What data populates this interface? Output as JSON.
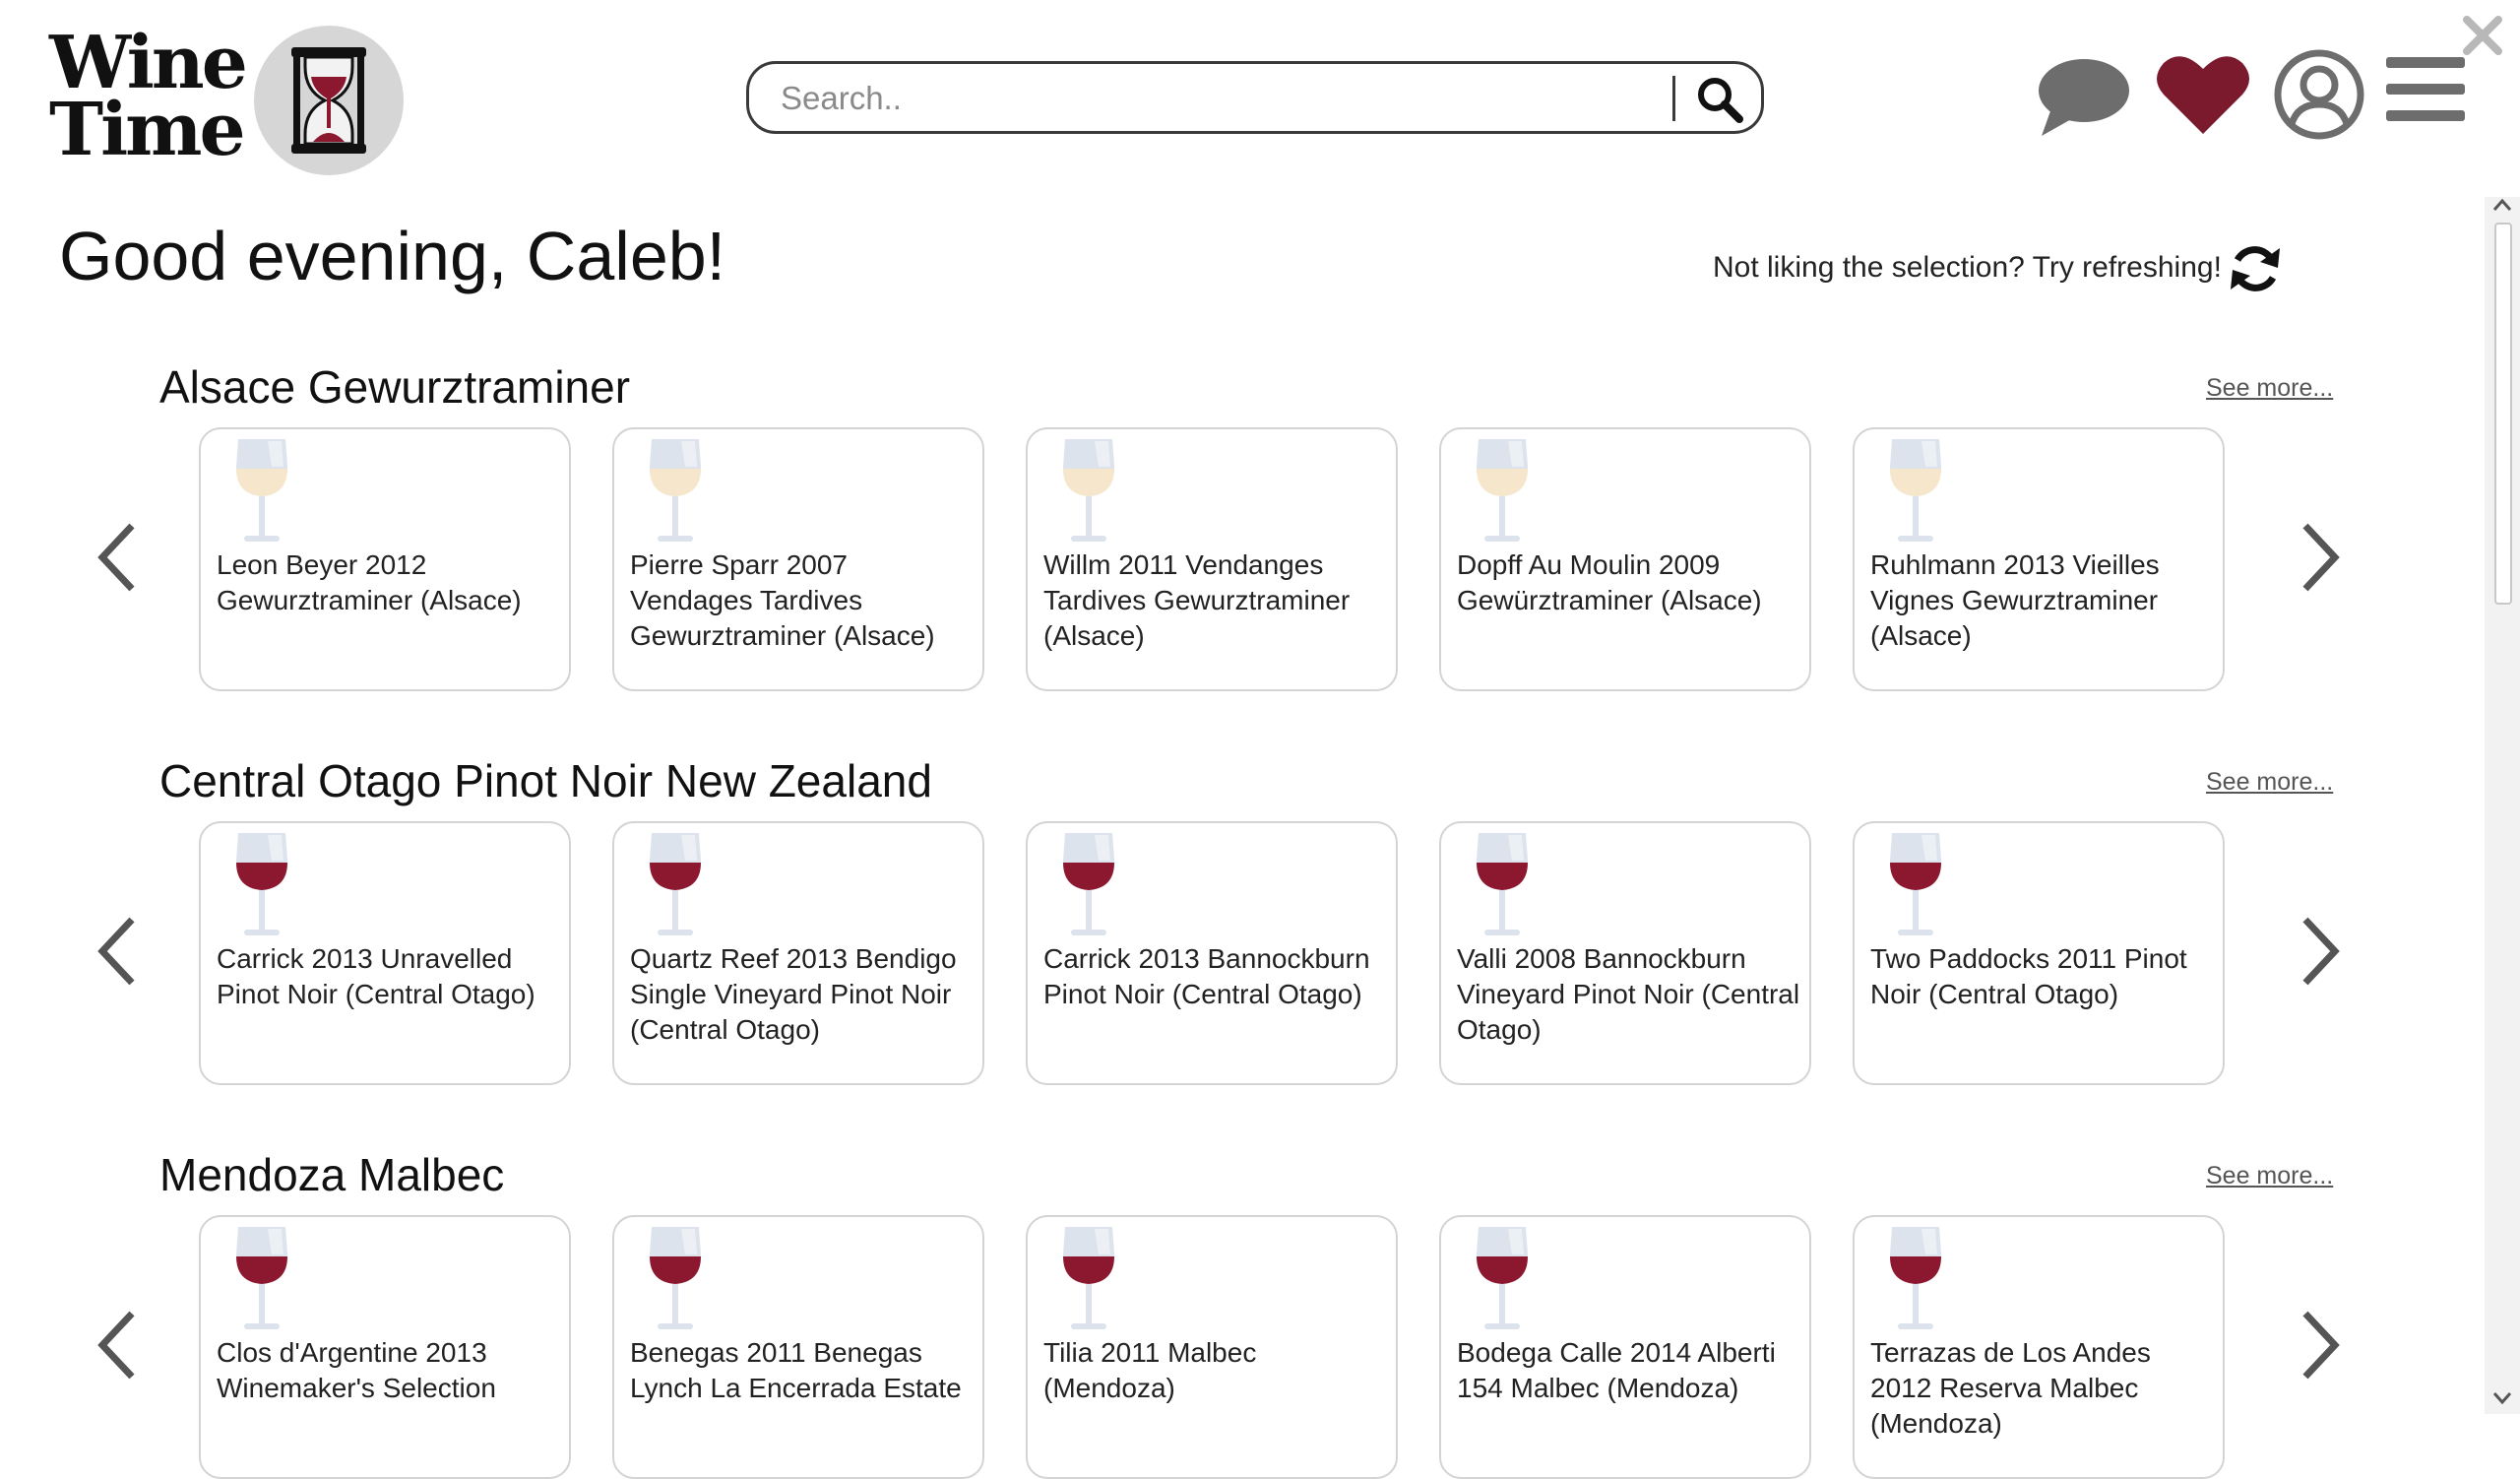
{
  "header": {
    "logo_line1": "Wine",
    "logo_line2": "Time",
    "search_placeholder": "Search..",
    "icons": [
      "chat-icon",
      "heart-icon",
      "user-icon",
      "menu-icon",
      "close-icon"
    ]
  },
  "greeting": "Good evening, Caleb!",
  "refresh_prompt": "Not liking the selection? Try refreshing!",
  "see_more_label": "See more...",
  "colors": {
    "accent": "#7b1a2c",
    "red_wine": "#8c1830",
    "white_wine": "#f5e6cc",
    "glass": "#dde3ec",
    "icon_gray": "#666666"
  },
  "sections": [
    {
      "title": "Alsace Gewurztraminer",
      "wine_color": "white",
      "wines": [
        "Leon Beyer 2012 Gewurztraminer (Alsace)",
        "Pierre Sparr 2007 Vendages Tardives Gewurztraminer (Alsace)",
        "Willm 2011 Vendanges Tardives Gewurztraminer (Alsace)",
        "Dopff Au Moulin 2009 Gewürztraminer (Alsace)",
        "Ruhlmann 2013 Vieilles Vignes Gewurztraminer (Alsace)"
      ]
    },
    {
      "title": "Central Otago Pinot Noir New Zealand",
      "wine_color": "red",
      "wines": [
        "Carrick 2013 Unravelled Pinot Noir (Central Otago)",
        "Quartz Reef 2013 Bendigo Single Vineyard Pinot Noir (Central Otago)",
        "Carrick 2013 Bannockburn Pinot Noir (Central Otago)",
        "Valli 2008 Bannockburn Vineyard Pinot Noir (Central Otago)",
        "Two Paddocks 2011 Pinot Noir (Central Otago)"
      ]
    },
    {
      "title": "Mendoza Malbec",
      "wine_color": "red",
      "wines": [
        "Clos d'Argentine 2013 Winemaker's Selection",
        "Benegas 2011 Benegas Lynch La Encerrada Estate",
        "Tilia 2011 Malbec (Mendoza)",
        "Bodega Calle 2014 Alberti 154 Malbec (Mendoza)",
        "Terrazas de Los Andes 2012 Reserva Malbec (Mendoza)"
      ]
    }
  ]
}
